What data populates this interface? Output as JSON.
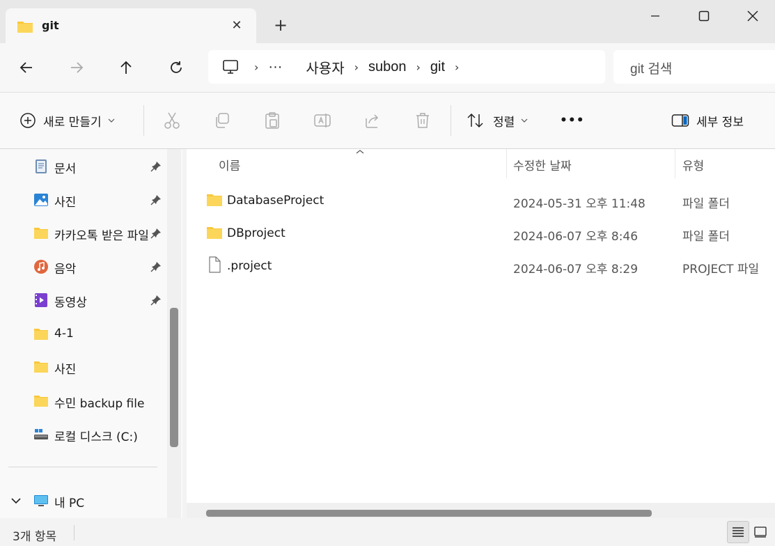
{
  "tab": {
    "title": "git",
    "close": "✕",
    "new": "+"
  },
  "nav": {
    "breadcrumb": [
      "사용자",
      "subon",
      "git"
    ],
    "overflow": "···",
    "search_placeholder": "git 검색"
  },
  "toolbar": {
    "new_label": "새로 만들기",
    "sort_label": "정렬",
    "more_label": "•••",
    "details_label": "세부 정보"
  },
  "sidebar": {
    "items": [
      {
        "label": "문서",
        "icon": "document-icon",
        "pinned": true
      },
      {
        "label": "사진",
        "icon": "pictures-icon",
        "pinned": true
      },
      {
        "label": "카카오톡 받은 파일",
        "icon": "folder-icon",
        "pinned": true
      },
      {
        "label": "음악",
        "icon": "music-icon",
        "pinned": true
      },
      {
        "label": "동영상",
        "icon": "video-icon",
        "pinned": true
      },
      {
        "label": "4-1",
        "icon": "folder-icon",
        "pinned": false
      },
      {
        "label": "사진",
        "icon": "folder-icon",
        "pinned": false
      },
      {
        "label": "수민 backup file",
        "icon": "folder-icon",
        "pinned": false
      },
      {
        "label": "로컬 디스크 (C:)",
        "icon": "drive-icon",
        "pinned": false
      }
    ],
    "this_pc": "내 PC"
  },
  "columns": {
    "name": "이름",
    "modified": "수정한 날짜",
    "type": "유형"
  },
  "files": [
    {
      "name": "DatabaseProject",
      "modified": "2024-05-31 오후 11:48",
      "type": "파일 폴더",
      "icon": "folder-icon"
    },
    {
      "name": "DBproject",
      "modified": "2024-06-07 오후 8:46",
      "type": "파일 폴더",
      "icon": "folder-icon"
    },
    {
      "name": ".project",
      "modified": "2024-06-07 오후 8:29",
      "type": "PROJECT 파일",
      "icon": "file-icon"
    }
  ],
  "status": {
    "count": "3개 항목"
  },
  "colors": {
    "folder": "#f8c83c",
    "accent": "#0067c0"
  }
}
